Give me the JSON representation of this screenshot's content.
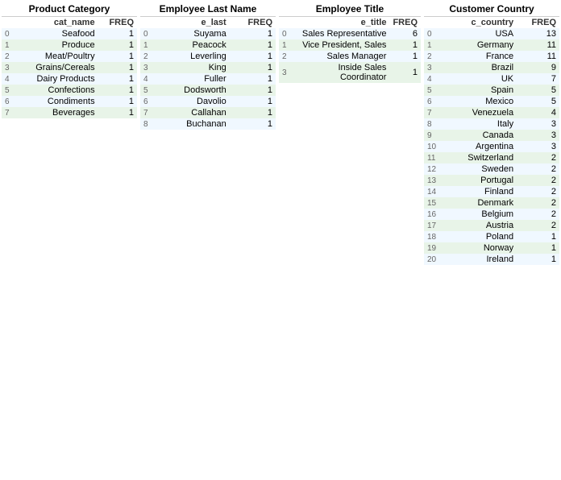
{
  "sections": [
    {
      "id": "product-category",
      "header": "Product Category",
      "col1": "cat_name",
      "col2": "FREQ",
      "rows": [
        {
          "idx": "0",
          "name": "Seafood",
          "freq": "1"
        },
        {
          "idx": "1",
          "name": "Produce",
          "freq": "1"
        },
        {
          "idx": "2",
          "name": "Meat/Poultry",
          "freq": "1"
        },
        {
          "idx": "3",
          "name": "Grains/Cereals",
          "freq": "1"
        },
        {
          "idx": "4",
          "name": "Dairy Products",
          "freq": "1"
        },
        {
          "idx": "5",
          "name": "Confections",
          "freq": "1"
        },
        {
          "idx": "6",
          "name": "Condiments",
          "freq": "1"
        },
        {
          "idx": "7",
          "name": "Beverages",
          "freq": "1"
        }
      ]
    },
    {
      "id": "employee-last-name",
      "header": "Employee Last Name",
      "col1": "e_last",
      "col2": "FREQ",
      "rows": [
        {
          "idx": "0",
          "name": "Suyama",
          "freq": "1"
        },
        {
          "idx": "1",
          "name": "Peacock",
          "freq": "1"
        },
        {
          "idx": "2",
          "name": "Leverling",
          "freq": "1"
        },
        {
          "idx": "3",
          "name": "King",
          "freq": "1"
        },
        {
          "idx": "4",
          "name": "Fuller",
          "freq": "1"
        },
        {
          "idx": "5",
          "name": "Dodsworth",
          "freq": "1"
        },
        {
          "idx": "6",
          "name": "Davolio",
          "freq": "1"
        },
        {
          "idx": "7",
          "name": "Callahan",
          "freq": "1"
        },
        {
          "idx": "8",
          "name": "Buchanan",
          "freq": "1"
        }
      ]
    },
    {
      "id": "employee-title",
      "header": "Employee Title",
      "col1": "e_title",
      "col2": "FREQ",
      "rows": [
        {
          "idx": "0",
          "name": "Sales Representative",
          "freq": "6"
        },
        {
          "idx": "1",
          "name": "Vice President, Sales",
          "freq": "1"
        },
        {
          "idx": "2",
          "name": "Sales Manager",
          "freq": "1"
        },
        {
          "idx": "3",
          "name": "Inside Sales Coordinator",
          "freq": "1"
        }
      ]
    },
    {
      "id": "customer-country",
      "header": "Customer Country",
      "col1": "c_country",
      "col2": "FREQ",
      "rows": [
        {
          "idx": "0",
          "name": "USA",
          "freq": "13"
        },
        {
          "idx": "1",
          "name": "Germany",
          "freq": "11"
        },
        {
          "idx": "2",
          "name": "France",
          "freq": "11"
        },
        {
          "idx": "3",
          "name": "Brazil",
          "freq": "9"
        },
        {
          "idx": "4",
          "name": "UK",
          "freq": "7"
        },
        {
          "idx": "5",
          "name": "Spain",
          "freq": "5"
        },
        {
          "idx": "6",
          "name": "Mexico",
          "freq": "5"
        },
        {
          "idx": "7",
          "name": "Venezuela",
          "freq": "4"
        },
        {
          "idx": "8",
          "name": "Italy",
          "freq": "3"
        },
        {
          "idx": "9",
          "name": "Canada",
          "freq": "3"
        },
        {
          "idx": "10",
          "name": "Argentina",
          "freq": "3"
        },
        {
          "idx": "11",
          "name": "Switzerland",
          "freq": "2"
        },
        {
          "idx": "12",
          "name": "Sweden",
          "freq": "2"
        },
        {
          "idx": "13",
          "name": "Portugal",
          "freq": "2"
        },
        {
          "idx": "14",
          "name": "Finland",
          "freq": "2"
        },
        {
          "idx": "15",
          "name": "Denmark",
          "freq": "2"
        },
        {
          "idx": "16",
          "name": "Belgium",
          "freq": "2"
        },
        {
          "idx": "17",
          "name": "Austria",
          "freq": "2"
        },
        {
          "idx": "18",
          "name": "Poland",
          "freq": "1"
        },
        {
          "idx": "19",
          "name": "Norway",
          "freq": "1"
        },
        {
          "idx": "20",
          "name": "Ireland",
          "freq": "1"
        }
      ]
    }
  ]
}
